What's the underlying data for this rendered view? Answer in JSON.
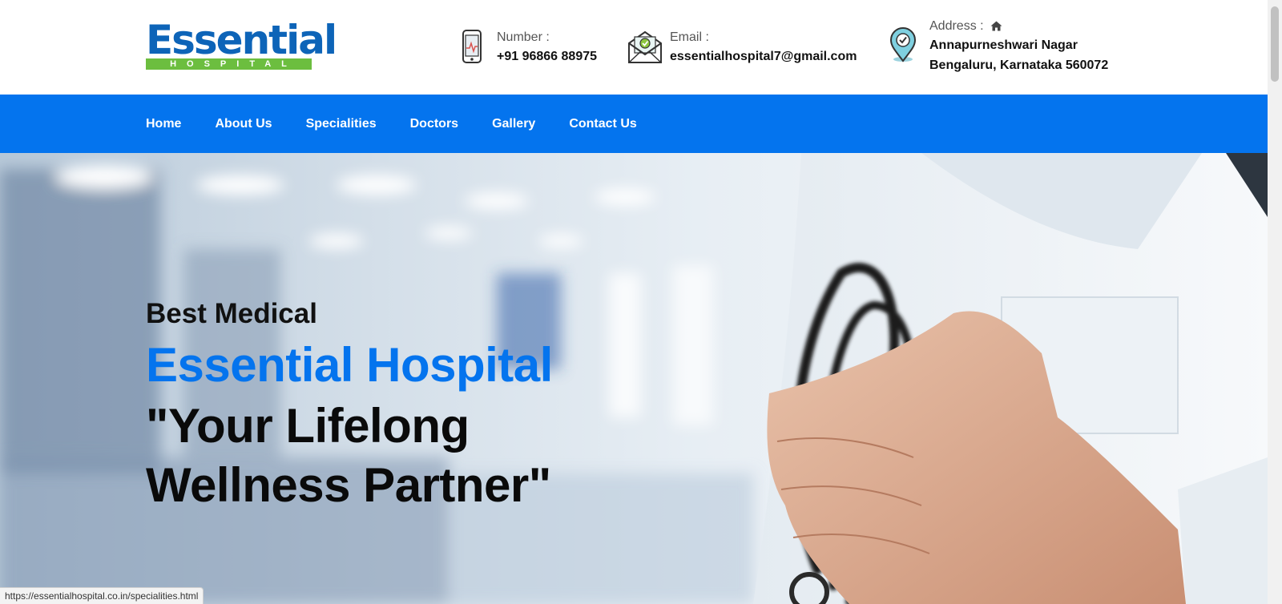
{
  "header": {
    "logo": {
      "top": "Essential",
      "bottom": "HOSPITAL"
    },
    "phone": {
      "label": "Number :",
      "value": "+91 96866 88975"
    },
    "email": {
      "label": "Email :",
      "value": "essentialhospital7@gmail.com"
    },
    "address": {
      "label": "Address :",
      "line1": "Annapurneshwari Nagar",
      "line2": "Bengaluru, Karnataka 560072"
    }
  },
  "nav": {
    "items": [
      {
        "label": "Home"
      },
      {
        "label": "About Us"
      },
      {
        "label": "Specialities"
      },
      {
        "label": "Doctors"
      },
      {
        "label": "Gallery"
      },
      {
        "label": "Contact Us"
      }
    ]
  },
  "hero": {
    "pre": "Best Medical",
    "title": "Essential Hospital",
    "tagline": "\"Your Lifelong Wellness Partner\""
  },
  "status": {
    "url": "https://essentialhospital.co.in/specialities.html"
  },
  "colors": {
    "brand_blue": "#0474ee",
    "logo_green": "#6cbe3f",
    "logo_blue": "#0d64b8"
  },
  "icons": {
    "phone": "tablet-icon",
    "email": "envelope-check-icon",
    "address": "location-pin-icon",
    "home": "home-icon"
  }
}
